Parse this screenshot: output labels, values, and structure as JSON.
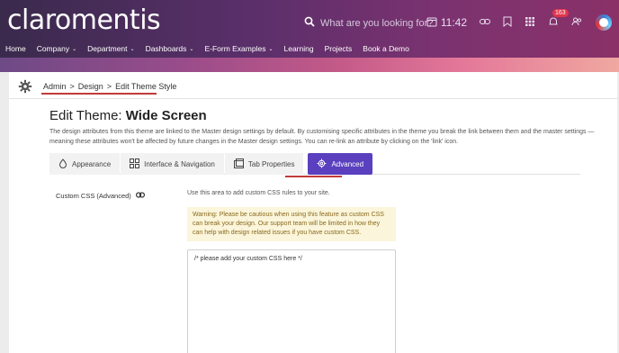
{
  "header": {
    "logo_text": "claromentis",
    "search_placeholder": "What are you looking for?",
    "time": "11:42",
    "notification_count": "163"
  },
  "nav": {
    "items": [
      {
        "label": "Home",
        "dropdown": false
      },
      {
        "label": "Company",
        "dropdown": true
      },
      {
        "label": "Department",
        "dropdown": true
      },
      {
        "label": "Dashboards",
        "dropdown": true
      },
      {
        "label": "E-Form Examples",
        "dropdown": true
      },
      {
        "label": "Learning",
        "dropdown": false
      },
      {
        "label": "Projects",
        "dropdown": false
      },
      {
        "label": "Book a Demo",
        "dropdown": false
      }
    ],
    "caret": "⌄"
  },
  "breadcrumb": {
    "items": [
      "Admin",
      "Design",
      "Edit Theme Style"
    ],
    "separator": ">"
  },
  "page": {
    "title_prefix": "Edit Theme:",
    "title_name": "Wide Screen",
    "description": "The design attributes from this theme are linked to the Master design settings by default. By customising specific attributes in the theme you break the link between them and the master settings — meaning these attributes won't be affected by future changes in the Master design settings. You can re-link an attribute by clicking on the 'link' icon."
  },
  "tabs": [
    {
      "label": "Appearance",
      "icon": "droplet-icon"
    },
    {
      "label": "Interface & Navigation",
      "icon": "grid-icon"
    },
    {
      "label": "Tab Properties",
      "icon": "tab-icon"
    },
    {
      "label": "Advanced",
      "icon": "gear-icon",
      "active": true
    }
  ],
  "custom_css": {
    "label": "Custom CSS (Advanced)",
    "help": "Use this area to add custom CSS rules to your site.",
    "warning": "Warning: Please be cautious when using this feature as custom CSS can break your design. Our support team will be limited in how they can help with design related issues if you have custom CSS.",
    "value": "/* please add your custom CSS here */"
  },
  "colors": {
    "accent": "#5a3fbf",
    "highlight_underline": "#c23a3a",
    "warning_bg": "#fbf5db"
  }
}
